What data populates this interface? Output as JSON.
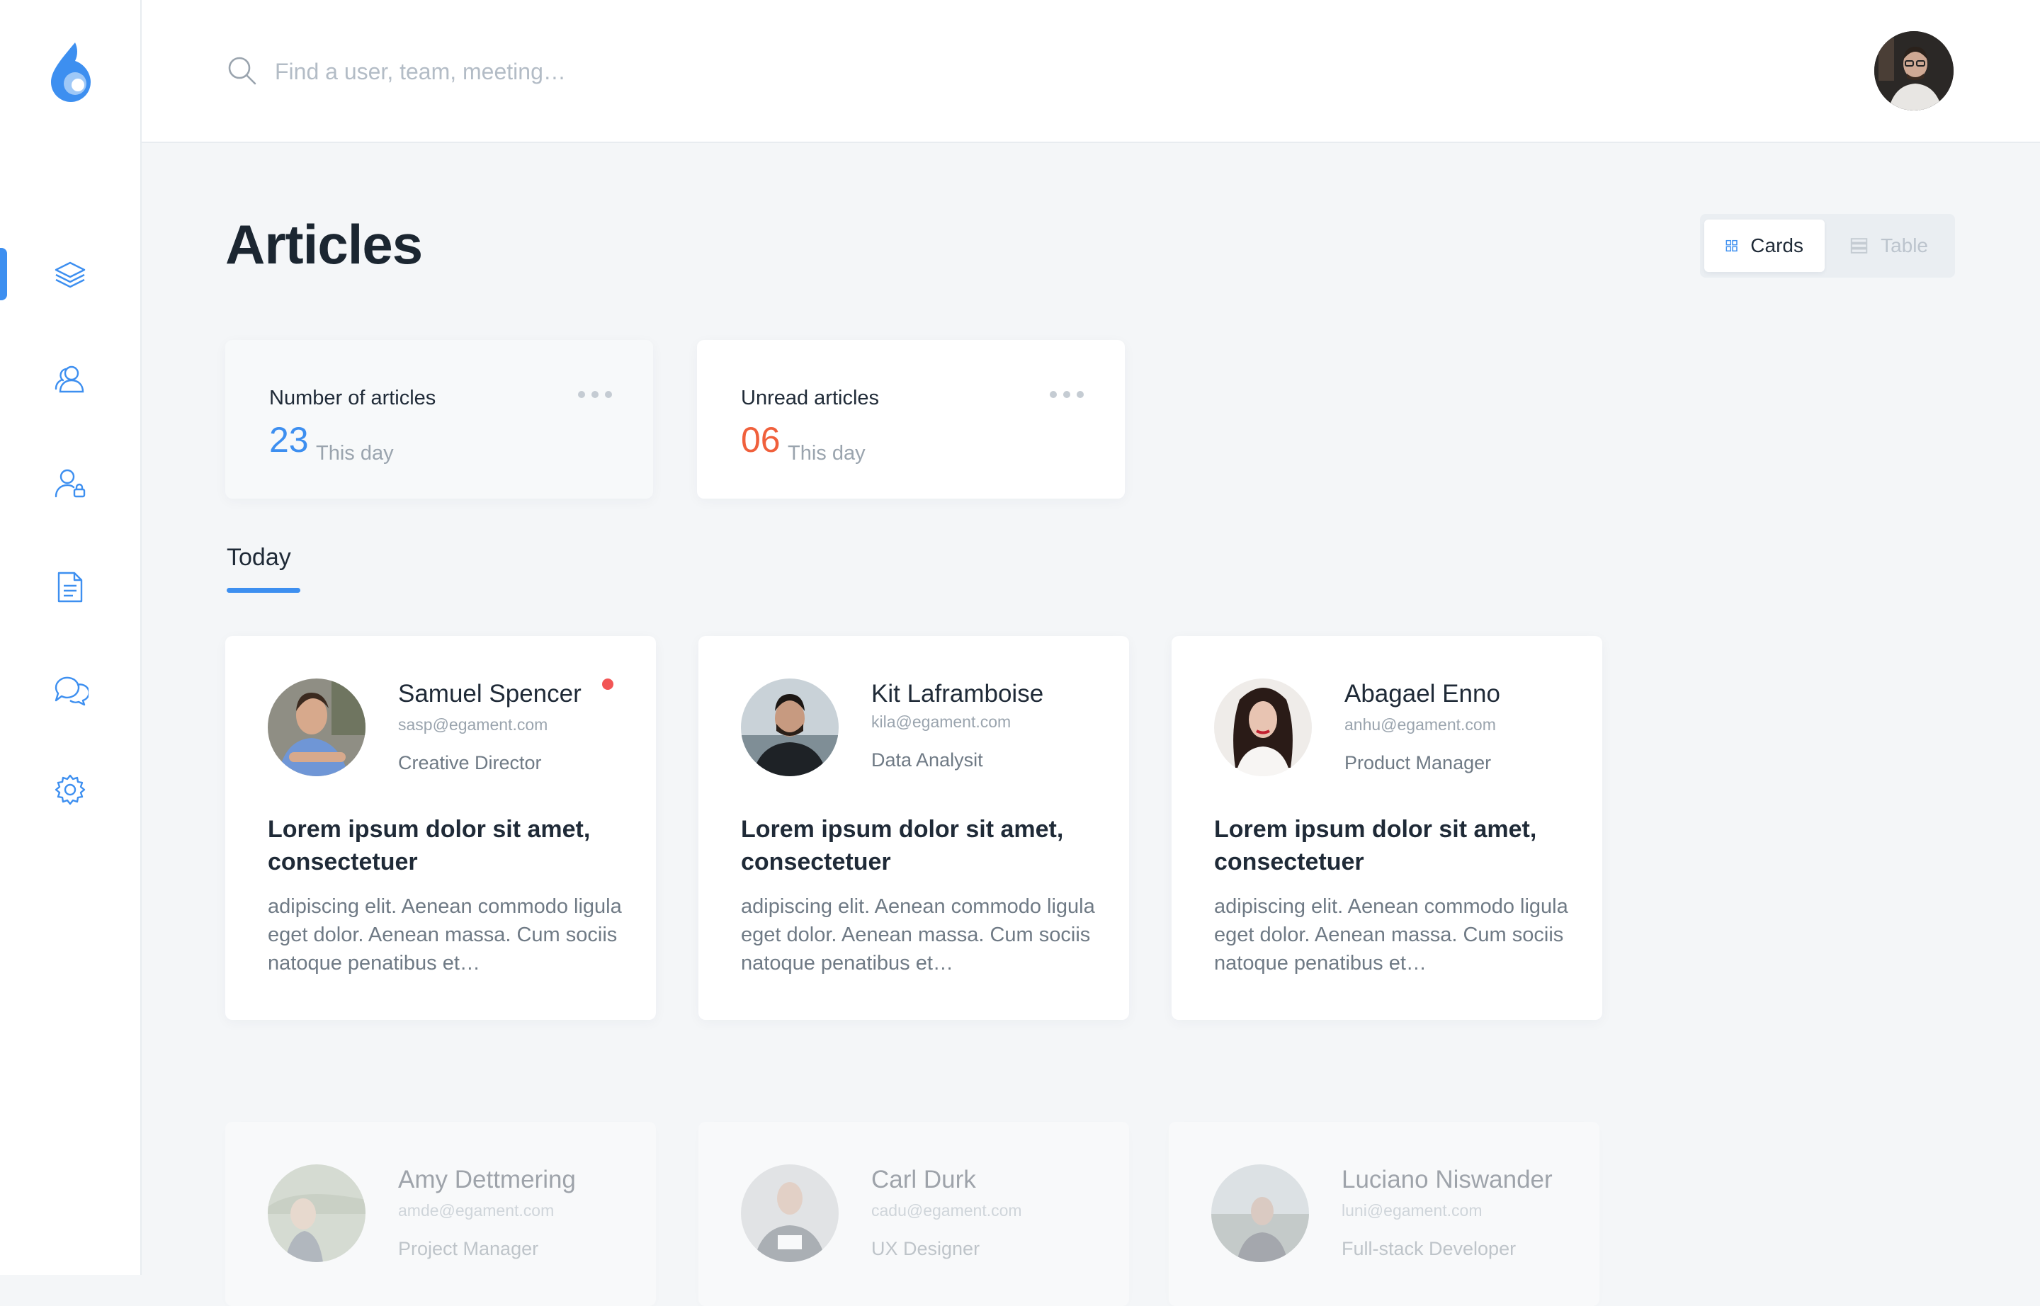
{
  "sidebar": {
    "logo_icon": "droplet-logo",
    "items": [
      {
        "name": "layers",
        "icon": "layers-icon",
        "active": true
      },
      {
        "name": "users",
        "icon": "users-icon",
        "active": false
      },
      {
        "name": "user-lock",
        "icon": "user-lock-icon",
        "active": false
      },
      {
        "name": "document",
        "icon": "document-icon",
        "active": false
      },
      {
        "name": "chat",
        "icon": "chat-icon",
        "active": false
      },
      {
        "name": "settings",
        "icon": "gear-icon",
        "active": false
      }
    ]
  },
  "header": {
    "search_placeholder": "Find a user, team, meeting…",
    "search_value": ""
  },
  "page": {
    "title": "Articles",
    "view_toggle": {
      "cards_label": "Cards",
      "table_label": "Table",
      "selected": "Cards"
    }
  },
  "stats": [
    {
      "label": "Number of articles",
      "value": "23",
      "sub": "This day",
      "value_color": "#3d8ff0"
    },
    {
      "label": "Unread articles",
      "value": "06",
      "sub": "This day",
      "value_color": "#f0603c"
    }
  ],
  "section": {
    "label": "Today"
  },
  "articles": [
    {
      "name": "Samuel Spencer",
      "email": "sasp@egament.com",
      "role": "Creative Director",
      "unread": true,
      "title": "Lorem ipsum dolor sit amet, consectetuer",
      "excerpt": "adipiscing elit. Aenean commodo ligula eget dolor. Aenean massa. Cum sociis natoque penatibus et…"
    },
    {
      "name": "Kit Laframboise",
      "email": "kila@egament.com",
      "role": "Data Analysit",
      "unread": false,
      "title": "Lorem ipsum dolor sit amet, consectetuer",
      "excerpt": "adipiscing elit. Aenean commodo ligula eget dolor. Aenean massa. Cum sociis natoque penatibus et…"
    },
    {
      "name": "Abagael Enno",
      "email": "anhu@egament.com",
      "role": "Product Manager",
      "unread": false,
      "title": "Lorem ipsum dolor sit amet, consectetuer",
      "excerpt": "adipiscing elit. Aenean commodo ligula eget dolor. Aenean massa. Cum sociis natoque penatibus et…"
    },
    {
      "name": "Amy Dettmering",
      "email": "amde@egament.com",
      "role": "Project Manager"
    },
    {
      "name": "Carl Durk",
      "email": "cadu@egament.com",
      "role": "UX Designer"
    },
    {
      "name": "Luciano Niswander",
      "email": "luni@egament.com",
      "role": "Full-stack Developer"
    }
  ],
  "colors": {
    "accent": "#3d8ff0",
    "unread_dot": "#f25555",
    "warning": "#f0603c"
  }
}
